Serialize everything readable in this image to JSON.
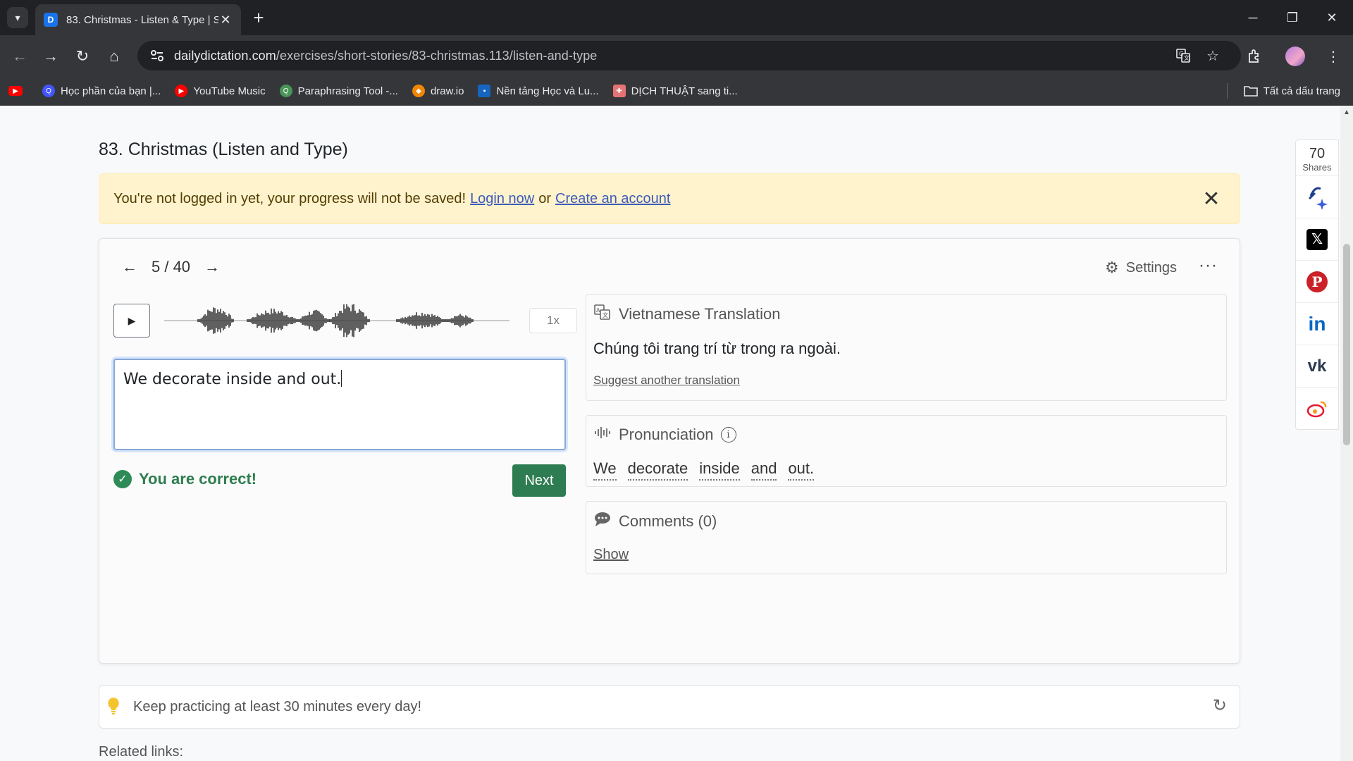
{
  "browser": {
    "tab_title": "83. Christmas - Listen & Type | S",
    "favicon_letter": "D",
    "url_host": "dailydictation.com",
    "url_path": "/exercises/short-stories/83-christmas.113/listen-and-type",
    "bookmarks": [
      {
        "label": "",
        "icon": "youtube-icon",
        "color": "#ff0000"
      },
      {
        "label": "Học phần của bạn |...",
        "icon": "quizlet-icon",
        "color": "#4255ff"
      },
      {
        "label": "YouTube Music",
        "icon": "youtube-music-icon",
        "color": "#ff0000"
      },
      {
        "label": "Paraphrasing Tool -...",
        "icon": "quillbot-icon",
        "color": "#499557"
      },
      {
        "label": "draw.io",
        "icon": "drawio-icon",
        "color": "#f08705"
      },
      {
        "label": "Nền tảng Học và Lu...",
        "icon": "learning-platform-icon",
        "color": "#1565c0"
      },
      {
        "label": "DỊCH THUẬT sang ti...",
        "icon": "translate-site-icon",
        "color": "#e57373"
      }
    ],
    "all_bookmarks": "Tất cả dấu trang"
  },
  "page": {
    "title": "83. Christmas (Listen and Type)",
    "alert": {
      "message": "You're not logged in yet, your progress will not be saved!",
      "login": "Login now",
      "or": "or",
      "create": "Create an account"
    },
    "exercise": {
      "prev": "←",
      "counter": "5 / 40",
      "next_arrow": "→",
      "settings": "Settings",
      "more": "···",
      "speed": "1x",
      "answer": "We decorate inside and out.",
      "result": "You are correct!",
      "next_button": "Next"
    },
    "translation": {
      "heading": "Vietnamese Translation",
      "text": "Chúng tôi trang trí từ trong ra ngoài.",
      "suggest": "Suggest another translation"
    },
    "pronunciation": {
      "heading": "Pronunciation",
      "info": "i",
      "words": [
        "We",
        "decorate",
        "inside",
        "and",
        "out."
      ]
    },
    "comments": {
      "heading": "Comments (0)",
      "show": "Show"
    },
    "tip": "Keep practicing at least 30 minutes every day!",
    "related": "Related links:"
  },
  "share": {
    "count": "70",
    "label": "Shares",
    "networks": [
      {
        "name": "facebook-ai-icon",
        "glyph": "f",
        "color": "#1877f2"
      },
      {
        "name": "x-icon",
        "glyph": "X",
        "color": "#000000"
      },
      {
        "name": "pinterest-icon",
        "glyph": "P",
        "color": "#cb2027"
      },
      {
        "name": "linkedin-icon",
        "glyph": "in",
        "color": "#0a66c2"
      },
      {
        "name": "vk-icon",
        "glyph": "vk",
        "color": "#4c75a3"
      },
      {
        "name": "weibo-icon",
        "glyph": "W",
        "color": "#e6162d"
      }
    ]
  },
  "colors": {
    "accent": "#2e7d52",
    "alert_bg": "#fff3cd",
    "link": "#3d5bb8"
  }
}
